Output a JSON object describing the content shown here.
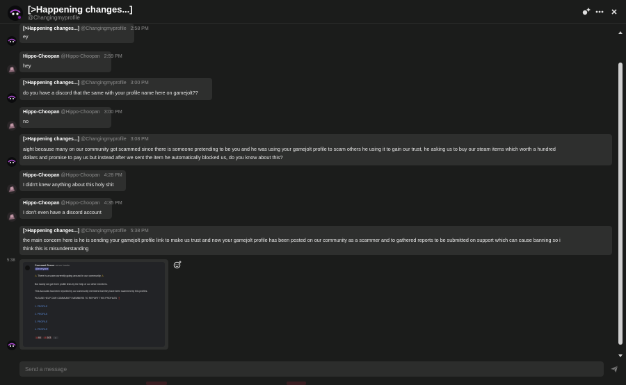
{
  "header": {
    "title": "[>Happening changes...]",
    "username": "@Changingmyprofile"
  },
  "messages": [
    {
      "name": "[>Happening changes...]",
      "user": "@Changingmyprofile",
      "time": "2:58 PM",
      "lines": [
        "ey"
      ]
    },
    {
      "name": "Hippo-Choopan",
      "user": "@Hippo-Choopan",
      "time": "2:59 PM",
      "lines": [
        "hey"
      ]
    },
    {
      "name": "[>Happening changes...]",
      "user": "@Changingmyprofile",
      "time": "3:00 PM",
      "lines": [
        "do you have a discord that the same with your profile name here on gamejolt??"
      ]
    },
    {
      "name": "Hippo-Choopan",
      "user": "@Hippo-Choopan",
      "time": "3:00 PM",
      "lines": [
        "no"
      ]
    },
    {
      "name": "[>Happening changes...]",
      "user": "@Changingmyprofile",
      "time": "3:08 PM",
      "lines": [
        "aight because many on our community got scammed since there is someone pretending to be you and he was using your gamejolt profile to scam others he using it to gain our trust, he asking us to buy our steam items which worth a hundred",
        "dollars and promise to pay us but instead after we sent the item he automatically blocked us, do you know about this?"
      ]
    },
    {
      "name": "Hippo-Choopan",
      "user": "@Hippo-Choopan",
      "time": "4:28 PM",
      "lines": [
        "I didn't knew anything about this holy shit"
      ]
    },
    {
      "name": "Hippo-Choopan",
      "user": "@Hippo-Choopan",
      "time": "4:35 PM",
      "lines": [
        "I don't even have a discord account"
      ]
    },
    {
      "name": "[>Happening changes...]",
      "user": "@Changingmyprofile",
      "time": "5:38 PM",
      "lines": [
        "the main concern here is he is sending your gamejolt profile link to make us trust and now your gamejolt profile has been posted on our community as a scammer and to gathered reports to be submitted on support which can cause banning so i",
        "think this is misunderstanding"
      ]
    }
  ],
  "image_message": {
    "time": "5:38",
    "embed": {
      "author": "Covenant Server",
      "author_tag": "server leader",
      "mention": "@everyone",
      "warning": "There is a scam currently going around in our community",
      "line1": "But luckily we got three profile links by the help of our other members.",
      "line2": "This Accounts has been reported by our community members that they have been scammed by this profiles.",
      "line3": "PLEASE HELP OUR COMMUNITY MEMBERS TO REPORT THIS PROFILES",
      "profiles": [
        "1. PROFILE",
        "2. PROFILE",
        "3. PROFILE",
        "4. PROFILE"
      ],
      "reactions": [
        "64",
        "163"
      ]
    }
  },
  "composer": {
    "placeholder": "Send a message"
  },
  "colors": {
    "background": "#1b1c1b",
    "bubble": "#2e2f2e",
    "text": "#e8e8e8",
    "muted": "#8e8e8e",
    "avatar_accent": "#b04ad6"
  },
  "icons": [
    "friend-request-icon",
    "more-options-icon",
    "close-icon",
    "add-reaction-icon",
    "send-icon",
    "scroll-up-arrow-icon",
    "scroll-down-arrow-icon"
  ]
}
